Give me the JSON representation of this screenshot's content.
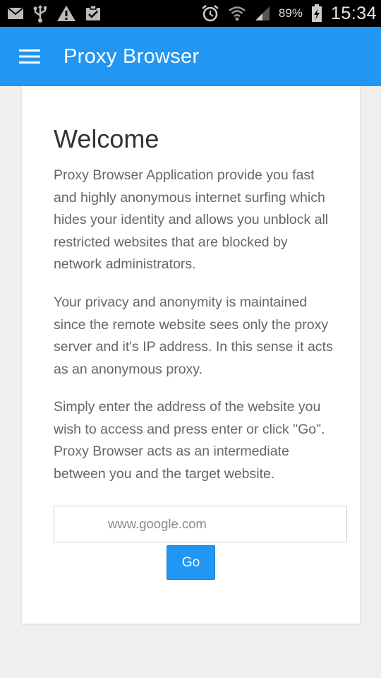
{
  "status_bar": {
    "left_icons": [
      "mail-icon",
      "usb-icon",
      "warning-icon",
      "clipboard-check-icon"
    ],
    "right_icons": [
      "alarm-icon",
      "wifi-icon",
      "signal-icon",
      "battery-charging-icon"
    ],
    "battery_percent": "89%",
    "time": "15:34"
  },
  "app_bar": {
    "title": "Proxy Browser",
    "color": "#2196f3"
  },
  "content": {
    "heading": "Welcome",
    "paragraphs": [
      "Proxy Browser Application provide you fast and highly anonymous internet surfing which hides your identity and allows you unblock all restricted websites that are blocked by network administrators.",
      "Your privacy and anonymity is maintained since the remote website sees only the proxy server and it's IP address. In this sense it acts as an anonymous proxy.",
      "Simply enter the address of the website you wish to access and press enter or click \"Go\". Proxy Browser acts as an intermediate between you and the target website."
    ],
    "url_input": {
      "value": "",
      "placeholder": "www.google.com"
    },
    "go_label": "Go"
  }
}
